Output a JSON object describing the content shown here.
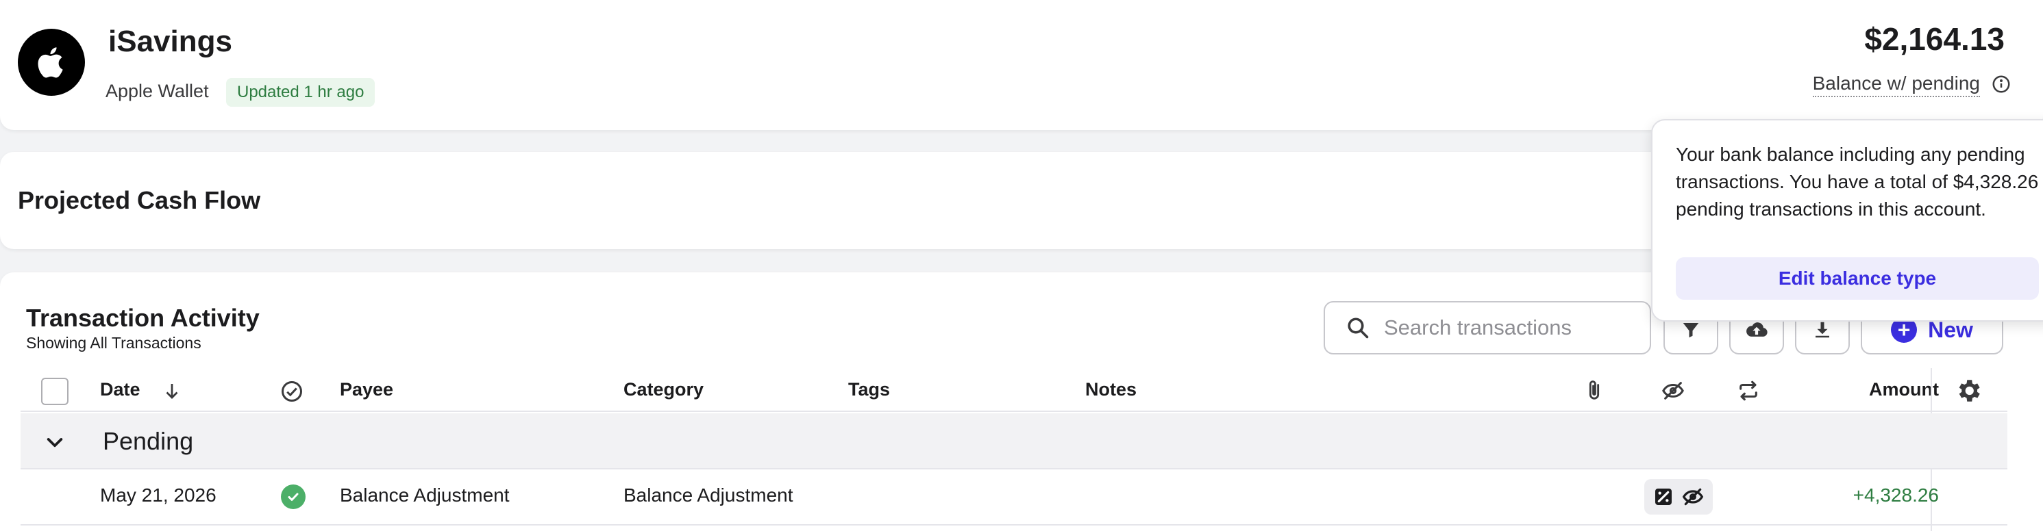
{
  "account": {
    "name": "iSavings",
    "institution": "Apple Wallet",
    "updated": "Updated 1 hr ago",
    "balance": "$2,164.13",
    "balance_label": "Balance w/ pending"
  },
  "cashflow": {
    "title": "Projected Cash Flow"
  },
  "transactions": {
    "title": "Transaction Activity",
    "subtitle": "Showing All Transactions",
    "search_placeholder": "Search transactions",
    "new_label": "New",
    "columns": {
      "date": "Date",
      "payee": "Payee",
      "category": "Category",
      "tags": "Tags",
      "notes": "Notes",
      "amount": "Amount"
    },
    "groups": [
      {
        "label": "Pending",
        "rows": [
          {
            "date": "May 21, 2026",
            "payee": "Balance Adjustment",
            "category": "Balance Adjustment",
            "amount": "+4,328.26"
          }
        ]
      }
    ]
  },
  "popover": {
    "line1": "Your bank balance including any pending transactions. You have a total of ",
    "amount": "$4,328.26",
    "line2": "  in pending transactions in this account.",
    "button": "Edit balance type"
  },
  "colors": {
    "accent": "#3b2ee0",
    "positive": "#2e7d41",
    "badge_bg": "#eaf6ec",
    "status_green": "#4caf68"
  },
  "icons": {
    "logo": "apple-logo-icon",
    "info": "info-icon",
    "search": "search-icon",
    "filter": "filter-icon",
    "upload": "cloud-upload-icon",
    "download": "download-icon",
    "plus": "plus-icon",
    "sort": "arrow-down-icon",
    "reviewed": "check-circle-icon",
    "attachment": "paperclip-icon",
    "hidden": "eye-off-icon",
    "recurring": "repeat-icon",
    "settings": "gear-icon",
    "chevron": "chevron-down-icon"
  }
}
